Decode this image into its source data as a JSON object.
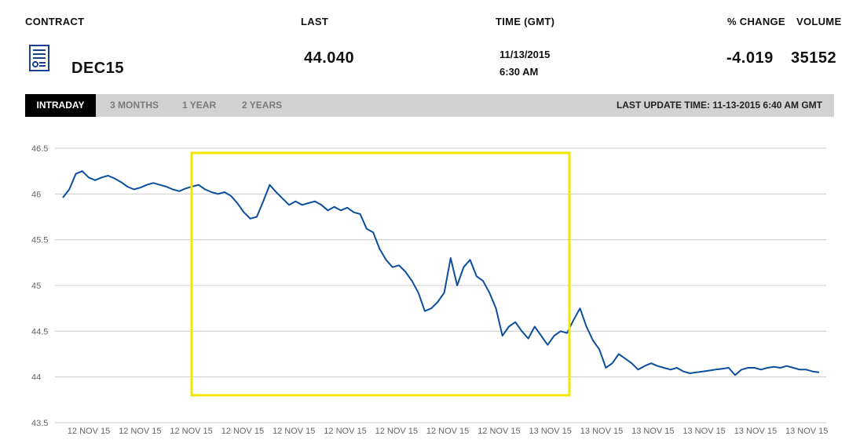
{
  "header": {
    "contract_label": "CONTRACT",
    "last_label": "LAST",
    "time_label": "TIME (GMT)",
    "change_label": "% CHANGE",
    "volume_label": "VOLUME"
  },
  "quote": {
    "contract": "DEC15",
    "last": "44.040",
    "date": "11/13/2015",
    "time": "6:30 AM",
    "change": "-4.019",
    "volume": "35152",
    "icon": "document-chart-icon"
  },
  "tabs": [
    {
      "label": "INTRADAY",
      "active": true
    },
    {
      "label": "3 MONTHS",
      "active": false
    },
    {
      "label": "1 YEAR",
      "active": false
    },
    {
      "label": "2 YEARS",
      "active": false
    }
  ],
  "last_update": "LAST UPDATE TIME: 11-13-2015 6:40 AM GMT",
  "colors": {
    "line": "#0b4f9c",
    "highlight": "#f2e600",
    "grid": "#cccccc",
    "icon": "#1a3f8f"
  },
  "chart_data": {
    "type": "line",
    "title": "",
    "xlabel": "",
    "ylabel": "",
    "ylim": [
      43.5,
      46.5
    ],
    "yticks": [
      "46.5",
      "46",
      "45.5",
      "45",
      "44.5",
      "44",
      "43.5"
    ],
    "x_tick_labels": [
      "12 NOV 15",
      "12 NOV 15",
      "12 NOV 15",
      "12 NOV 15",
      "12 NOV 15",
      "12 NOV 15",
      "12 NOV 15",
      "12 NOV 15",
      "12 NOV 15",
      "13 NOV 15",
      "13 NOV 15",
      "13 NOV 15",
      "13 NOV 15",
      "13 NOV 15",
      "13 NOV 15"
    ],
    "grid": true,
    "series": [
      {
        "values": [
          45.96,
          46.05,
          46.22,
          46.25,
          46.18,
          46.15,
          46.18,
          46.2,
          46.17,
          46.13,
          46.08,
          46.05,
          46.07,
          46.1,
          46.12,
          46.1,
          46.08,
          46.05,
          46.03,
          46.06,
          46.08,
          46.1,
          46.05,
          46.02,
          46.0,
          46.02,
          45.98,
          45.9,
          45.8,
          45.73,
          45.75,
          45.92,
          46.1,
          46.02,
          45.95,
          45.88,
          45.92,
          45.88,
          45.9,
          45.92,
          45.88,
          45.82,
          45.86,
          45.82,
          45.85,
          45.8,
          45.78,
          45.62,
          45.58,
          45.4,
          45.28,
          45.2,
          45.22,
          45.15,
          45.05,
          44.92,
          44.72,
          44.75,
          44.82,
          44.92,
          45.3,
          45.0,
          45.2,
          45.28,
          45.1,
          45.05,
          44.92,
          44.75,
          44.45,
          44.55,
          44.6,
          44.5,
          44.42,
          44.55,
          44.45,
          44.35,
          44.45,
          44.5,
          44.48,
          44.62,
          44.75,
          44.55,
          44.4,
          44.3,
          44.1,
          44.15,
          44.25,
          44.2,
          44.15,
          44.08,
          44.12,
          44.15,
          44.12,
          44.1,
          44.08,
          44.1,
          44.06,
          44.04,
          44.05,
          44.06,
          44.07,
          44.08,
          44.09,
          44.1,
          44.02,
          44.08,
          44.1,
          44.1,
          44.08,
          44.1,
          44.11,
          44.1,
          44.12,
          44.1,
          44.08,
          44.08,
          44.06,
          44.05
        ]
      }
    ],
    "highlight_box": {
      "x_range": [
        "12 NOV 15",
        "13 NOV 15"
      ],
      "y_range": [
        43.8,
        46.12
      ]
    }
  }
}
